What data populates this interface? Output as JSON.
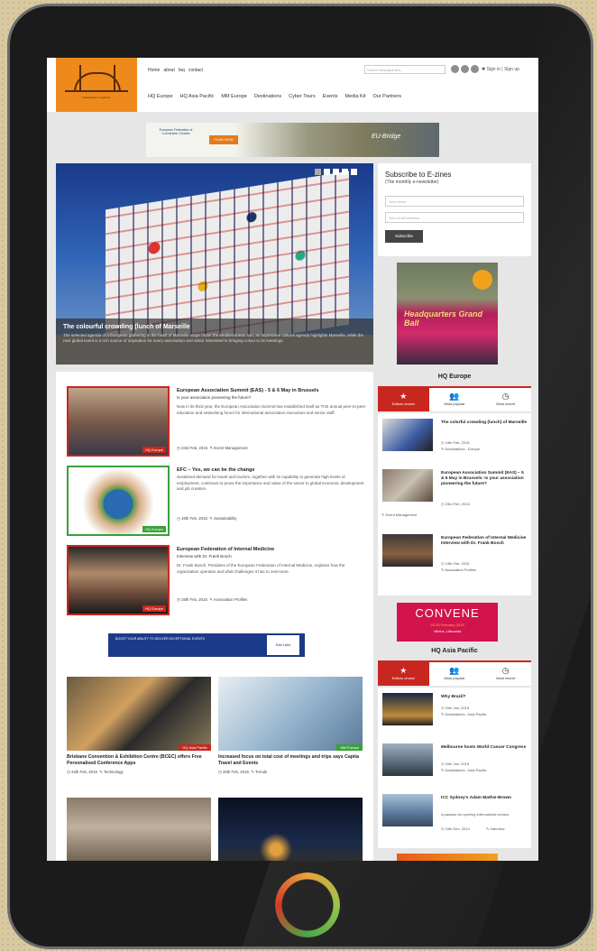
{
  "header": {
    "toplinks": [
      "Home",
      "about",
      "faq",
      "contact"
    ],
    "search_placeholder": "Search headquarters...",
    "social": [
      "facebook-icon",
      "twitter-icon",
      "linkedin-icon"
    ],
    "signin": "✱ Sign in | Sign up",
    "logo_tag": "headquarters magazine",
    "nav": [
      "HQ Europe",
      "HQ Asia Pacific",
      "MM Europe",
      "Destinations",
      "Cyber Tours",
      "Events",
      "Media Kit",
      "Our Partners"
    ]
  },
  "banner": {
    "left": "European Federation of Convention Centres",
    "button": "PLAN NOW",
    "brand": "EU-Bridge"
  },
  "hero": {
    "title": "The colourful crowding (lunch of Marseille",
    "desc": "The selected agenda of a European gathering in the heart of Marseille stage under the Mediterranean sun; an impressive cultural agenda highlights Marseille, while the next global event is a rich source of inspiration for every association and visitor interested in bringing colour to its meetings."
  },
  "subscribe": {
    "title": "Subscribe to E-zines",
    "subtitle": "(The monthly e-newsletter)",
    "name_ph": "Your name",
    "email_ph": "Your email address",
    "button": "Subscribe"
  },
  "ad_grandball": {
    "title": "Headquarters Grand Ball"
  },
  "hq_europe": {
    "title": "HQ Europe",
    "tabs": [
      {
        "icon": "★",
        "label": "Editors choice"
      },
      {
        "icon": "👥",
        "label": "Most popular"
      },
      {
        "icon": "◷",
        "label": "Most recent"
      }
    ],
    "items": [
      {
        "title": "The colorful crowding (lunch) of Marseille",
        "date": "◷ 24th Feb, 2015",
        "tag": "✎ Destinations - Europe"
      },
      {
        "title": "European Association Summit (EAS) – 5 & 6 May in Brussels: Is your association pioneering the future?",
        "date": "◷ 23rd Feb, 2015",
        "tag": "✎ Event Management"
      },
      {
        "title": "European Federation of Internal Medicine Interview with Dr. Frank Bosch",
        "date": "◷ 19th Feb, 2015",
        "tag": "✎ Association Profiles"
      }
    ]
  },
  "convene": {
    "title": "CONVENE",
    "line1": "23-25 February 2015",
    "line2": "Vilnius, Lithuania"
  },
  "hq_asia": {
    "title": "HQ Asia Pacific",
    "tabs": [
      {
        "icon": "★",
        "label": "Editors choice"
      },
      {
        "icon": "👥",
        "label": "Most popular"
      },
      {
        "icon": "◷",
        "label": "Most recent"
      }
    ],
    "items": [
      {
        "title": "Why Brazil?",
        "date": "◷ 20th Jan, 2015",
        "tag": "✎ Destinations - Asia Pacific"
      },
      {
        "title": "Melbourne hosts World Cancer Congress",
        "date": "◷ 20th Jan, 2015",
        "tag": "✎ Destinations - Asia Pacific"
      },
      {
        "title": "ICC Sydney's Adam Mathie-Brown",
        "sub": "A passion for opening international venues",
        "date": "◷ 16th Dec, 2014",
        "tag": "✎ Interview"
      }
    ]
  },
  "articles": [
    {
      "title": "European Association Summit (EAS) - 5 & 6 May in Brussels",
      "sub": "Is your association pioneering the future?",
      "desc": "Now in its third year, the European Association Summit has established itself as THE annual peer-to-peer education and networking forum for international association executives and senior staff.",
      "date": "◷ 23rd Feb, 2015",
      "tag": "✎ Event Management",
      "badge": "HQ Europe"
    },
    {
      "title": "EFC – Yes, we can be the change",
      "sub": "",
      "desc": "Sustained demand for travel and tourism, together with its capability to generate high levels of employment, continues to prove the importance and value of the sector to global economic development and job creation.",
      "date": "◷ 19th Feb, 2015",
      "tag": "✎ Sustainability",
      "badge": "HQ Europe"
    },
    {
      "title": "European Federation of Internal Medicine",
      "sub": "Interview with Dr. Frank Bosch",
      "desc": "Dr. Frank Bosch, President of the European Federation of Internal Medicine, explains how the organisation operates and what challenges it has to overcome.",
      "date": "◷ 19th Feb, 2015",
      "tag": "✎ Association Profiles",
      "badge": "HQ Europe"
    }
  ],
  "ad_leaderboard": {
    "text": "BOOST YOUR ABILITY TO DELIVER EXCEPTIONAL EVENTS",
    "logo": "Salt Lake"
  },
  "cards": [
    {
      "title": "Brisbane Convention & Exhibition Centre (BCEC) offers Free Personalised Conference Apps",
      "date": "◷ 24th Feb, 2015",
      "tag": "✎ Technology",
      "badge": "HQ Asia Pacific"
    },
    {
      "title": "Increased focus on total cost of meetings and trips says Capita Travel and Events",
      "date": "◷ 20th Feb, 2015",
      "tag": "✎ Trends",
      "badge": "MM Europe"
    }
  ]
}
